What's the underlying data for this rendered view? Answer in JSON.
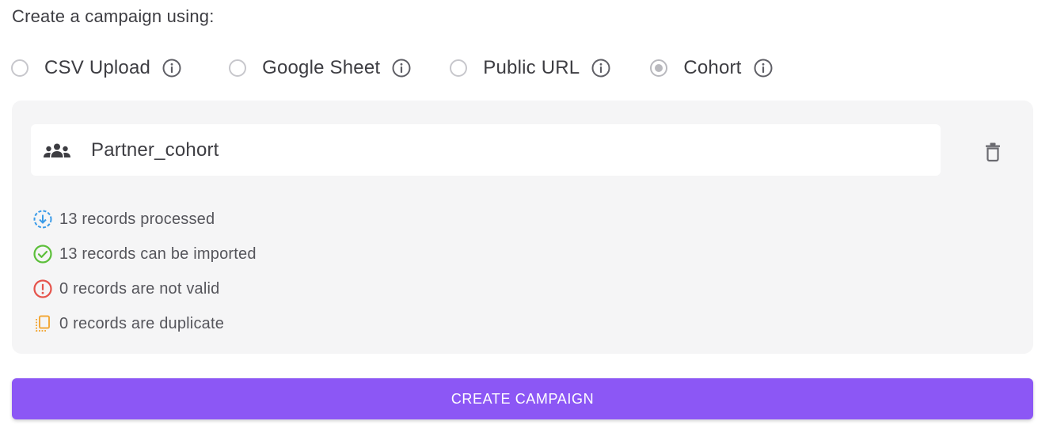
{
  "heading": "Create a campaign using:",
  "source_options": [
    {
      "label": "CSV Upload",
      "selected": false,
      "icon": "info-icon"
    },
    {
      "label": "Google Sheet",
      "selected": false,
      "icon": "info-icon"
    },
    {
      "label": "Public URL",
      "selected": false,
      "icon": "info-icon"
    },
    {
      "label": "Cohort",
      "selected": true,
      "icon": "info-icon"
    }
  ],
  "cohort": {
    "name": "Partner_cohort",
    "icon": "group-icon",
    "delete_icon": "trash-icon"
  },
  "stats": [
    {
      "text": "13 records processed",
      "icon": "download-circle-icon",
      "color": "#3b9be8"
    },
    {
      "text": "13 records can be imported",
      "icon": "check-circle-icon",
      "color": "#5cbf3a"
    },
    {
      "text": "0 records are not valid",
      "icon": "alert-circle-icon",
      "color": "#e5534b"
    },
    {
      "text": "0 records are duplicate",
      "icon": "copy-icon",
      "color": "#f2a93b"
    }
  ],
  "create_button": {
    "label": "CREATE CAMPAIGN",
    "color": "#8c57f5"
  },
  "colors": {
    "panel_bg": "#f5f5f6",
    "text": "#3d3d42",
    "radio_border": "#c7c7cc"
  }
}
